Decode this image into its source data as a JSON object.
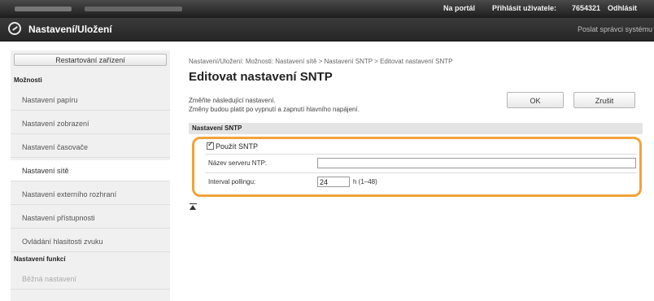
{
  "topbar": {
    "portal_link": "Na portál",
    "login_label": "Přihlásit uživatele:",
    "user_id": "7654321",
    "logout_link": "Odhlásit"
  },
  "titlebar": {
    "title": "Nastavení/Uložení",
    "mail_link": "Poslat správci systému"
  },
  "sidebar": {
    "restart_button": "Restartování zařízení",
    "options_header": "Možnosti",
    "items": [
      {
        "label": "Nastavení papíru"
      },
      {
        "label": "Nastavení zobrazení"
      },
      {
        "label": "Nastavení časovače"
      },
      {
        "label": "Nastavení sítě"
      },
      {
        "label": "Nastavení externího rozhraní"
      },
      {
        "label": "Nastavení přístupnosti"
      },
      {
        "label": "Ovládání hlasitosti zvuku"
      }
    ],
    "function_header": "Nastavení funkcí",
    "function_items": [
      {
        "label": "Běžná nastavení"
      }
    ]
  },
  "main": {
    "breadcrumb": "Nastavení/Uložení: Možnosti: Nastavení sítě > Nastavení SNTP > Editovat nastavení SNTP",
    "title": "Editovat nastavení SNTP",
    "info_line1": "Změňte následující nastavení.",
    "info_line2": "Změny budou platit po vypnutí a zapnutí hlavního napájení.",
    "ok_button": "OK",
    "cancel_button": "Zrušit",
    "section_title": "Nastavení SNTP",
    "use_sntp_label": "Použít SNTP",
    "use_sntp_checked": true,
    "ntp_server_label": "Název serveru NTP:",
    "ntp_server_value": "",
    "polling_label": "Interval pollingu:",
    "polling_value": "24",
    "polling_unit": "h (1–48)"
  },
  "colors": {
    "highlight": "#f2a33a",
    "header_bg": "#262626",
    "sidebar_bg": "#f0f0f0"
  },
  "icons": {
    "logo": "settings-logo-icon",
    "back_to_top": "back-to-top-icon"
  }
}
